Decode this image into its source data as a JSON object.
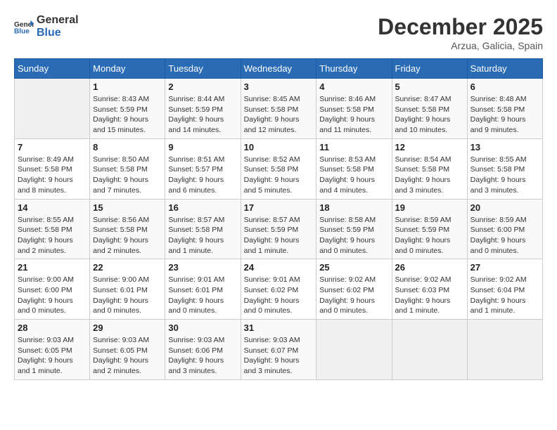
{
  "header": {
    "logo_general": "General",
    "logo_blue": "Blue",
    "month_year": "December 2025",
    "location": "Arzua, Galicia, Spain"
  },
  "calendar": {
    "days_of_week": [
      "Sunday",
      "Monday",
      "Tuesday",
      "Wednesday",
      "Thursday",
      "Friday",
      "Saturday"
    ],
    "weeks": [
      [
        {
          "day": "",
          "sunrise": "",
          "sunset": "",
          "daylight": "",
          "empty": true
        },
        {
          "day": "1",
          "sunrise": "Sunrise: 8:43 AM",
          "sunset": "Sunset: 5:59 PM",
          "daylight": "Daylight: 9 hours and 15 minutes."
        },
        {
          "day": "2",
          "sunrise": "Sunrise: 8:44 AM",
          "sunset": "Sunset: 5:59 PM",
          "daylight": "Daylight: 9 hours and 14 minutes."
        },
        {
          "day": "3",
          "sunrise": "Sunrise: 8:45 AM",
          "sunset": "Sunset: 5:58 PM",
          "daylight": "Daylight: 9 hours and 12 minutes."
        },
        {
          "day": "4",
          "sunrise": "Sunrise: 8:46 AM",
          "sunset": "Sunset: 5:58 PM",
          "daylight": "Daylight: 9 hours and 11 minutes."
        },
        {
          "day": "5",
          "sunrise": "Sunrise: 8:47 AM",
          "sunset": "Sunset: 5:58 PM",
          "daylight": "Daylight: 9 hours and 10 minutes."
        },
        {
          "day": "6",
          "sunrise": "Sunrise: 8:48 AM",
          "sunset": "Sunset: 5:58 PM",
          "daylight": "Daylight: 9 hours and 9 minutes."
        }
      ],
      [
        {
          "day": "7",
          "sunrise": "Sunrise: 8:49 AM",
          "sunset": "Sunset: 5:58 PM",
          "daylight": "Daylight: 9 hours and 8 minutes."
        },
        {
          "day": "8",
          "sunrise": "Sunrise: 8:50 AM",
          "sunset": "Sunset: 5:58 PM",
          "daylight": "Daylight: 9 hours and 7 minutes."
        },
        {
          "day": "9",
          "sunrise": "Sunrise: 8:51 AM",
          "sunset": "Sunset: 5:57 PM",
          "daylight": "Daylight: 9 hours and 6 minutes."
        },
        {
          "day": "10",
          "sunrise": "Sunrise: 8:52 AM",
          "sunset": "Sunset: 5:58 PM",
          "daylight": "Daylight: 9 hours and 5 minutes."
        },
        {
          "day": "11",
          "sunrise": "Sunrise: 8:53 AM",
          "sunset": "Sunset: 5:58 PM",
          "daylight": "Daylight: 9 hours and 4 minutes."
        },
        {
          "day": "12",
          "sunrise": "Sunrise: 8:54 AM",
          "sunset": "Sunset: 5:58 PM",
          "daylight": "Daylight: 9 hours and 3 minutes."
        },
        {
          "day": "13",
          "sunrise": "Sunrise: 8:55 AM",
          "sunset": "Sunset: 5:58 PM",
          "daylight": "Daylight: 9 hours and 3 minutes."
        }
      ],
      [
        {
          "day": "14",
          "sunrise": "Sunrise: 8:55 AM",
          "sunset": "Sunset: 5:58 PM",
          "daylight": "Daylight: 9 hours and 2 minutes."
        },
        {
          "day": "15",
          "sunrise": "Sunrise: 8:56 AM",
          "sunset": "Sunset: 5:58 PM",
          "daylight": "Daylight: 9 hours and 2 minutes."
        },
        {
          "day": "16",
          "sunrise": "Sunrise: 8:57 AM",
          "sunset": "Sunset: 5:58 PM",
          "daylight": "Daylight: 9 hours and 1 minute."
        },
        {
          "day": "17",
          "sunrise": "Sunrise: 8:57 AM",
          "sunset": "Sunset: 5:59 PM",
          "daylight": "Daylight: 9 hours and 1 minute."
        },
        {
          "day": "18",
          "sunrise": "Sunrise: 8:58 AM",
          "sunset": "Sunset: 5:59 PM",
          "daylight": "Daylight: 9 hours and 0 minutes."
        },
        {
          "day": "19",
          "sunrise": "Sunrise: 8:59 AM",
          "sunset": "Sunset: 5:59 PM",
          "daylight": "Daylight: 9 hours and 0 minutes."
        },
        {
          "day": "20",
          "sunrise": "Sunrise: 8:59 AM",
          "sunset": "Sunset: 6:00 PM",
          "daylight": "Daylight: 9 hours and 0 minutes."
        }
      ],
      [
        {
          "day": "21",
          "sunrise": "Sunrise: 9:00 AM",
          "sunset": "Sunset: 6:00 PM",
          "daylight": "Daylight: 9 hours and 0 minutes."
        },
        {
          "day": "22",
          "sunrise": "Sunrise: 9:00 AM",
          "sunset": "Sunset: 6:01 PM",
          "daylight": "Daylight: 9 hours and 0 minutes."
        },
        {
          "day": "23",
          "sunrise": "Sunrise: 9:01 AM",
          "sunset": "Sunset: 6:01 PM",
          "daylight": "Daylight: 9 hours and 0 minutes."
        },
        {
          "day": "24",
          "sunrise": "Sunrise: 9:01 AM",
          "sunset": "Sunset: 6:02 PM",
          "daylight": "Daylight: 9 hours and 0 minutes."
        },
        {
          "day": "25",
          "sunrise": "Sunrise: 9:02 AM",
          "sunset": "Sunset: 6:02 PM",
          "daylight": "Daylight: 9 hours and 0 minutes."
        },
        {
          "day": "26",
          "sunrise": "Sunrise: 9:02 AM",
          "sunset": "Sunset: 6:03 PM",
          "daylight": "Daylight: 9 hours and 1 minute."
        },
        {
          "day": "27",
          "sunrise": "Sunrise: 9:02 AM",
          "sunset": "Sunset: 6:04 PM",
          "daylight": "Daylight: 9 hours and 1 minute."
        }
      ],
      [
        {
          "day": "28",
          "sunrise": "Sunrise: 9:03 AM",
          "sunset": "Sunset: 6:05 PM",
          "daylight": "Daylight: 9 hours and 1 minute."
        },
        {
          "day": "29",
          "sunrise": "Sunrise: 9:03 AM",
          "sunset": "Sunset: 6:05 PM",
          "daylight": "Daylight: 9 hours and 2 minutes."
        },
        {
          "day": "30",
          "sunrise": "Sunrise: 9:03 AM",
          "sunset": "Sunset: 6:06 PM",
          "daylight": "Daylight: 9 hours and 3 minutes."
        },
        {
          "day": "31",
          "sunrise": "Sunrise: 9:03 AM",
          "sunset": "Sunset: 6:07 PM",
          "daylight": "Daylight: 9 hours and 3 minutes."
        },
        {
          "day": "",
          "sunrise": "",
          "sunset": "",
          "daylight": "",
          "empty": true
        },
        {
          "day": "",
          "sunrise": "",
          "sunset": "",
          "daylight": "",
          "empty": true
        },
        {
          "day": "",
          "sunrise": "",
          "sunset": "",
          "daylight": "",
          "empty": true
        }
      ]
    ]
  }
}
